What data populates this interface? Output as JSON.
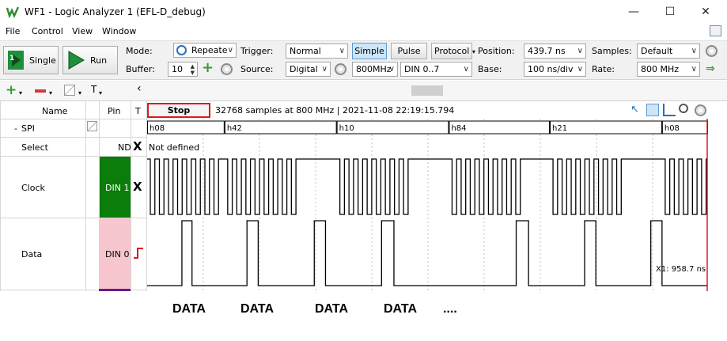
{
  "window": {
    "title": "WF1 - Logic Analyzer 1 (EFL-D_debug)",
    "minimize": "—",
    "maximize": "☐",
    "close": "✕"
  },
  "menu": [
    "File",
    "Control",
    "View",
    "Window"
  ],
  "toolbar": {
    "single_label": "Single",
    "run_label": "Run",
    "mode_label": "Mode:",
    "mode_value": "Repeate",
    "buffer_label": "Buffer:",
    "buffer_value": "10",
    "trigger_label": "Trigger:",
    "trigger_value": "Normal",
    "source_label": "Source:",
    "source_value": "Digital",
    "simple_label": "Simple",
    "pulse_label": "Pulse",
    "protocol_label": "Protocol",
    "freq_value": "800MHz",
    "din_value": "DIN 0..7",
    "position_label": "Position:",
    "position_value": "439.7 ns",
    "base_label": "Base:",
    "base_value": "100 ns/div",
    "samples_label": "Samples:",
    "samples_value": "Default",
    "rate_label": "Rate:",
    "rate_value": "800 MHz"
  },
  "toolbar2": {
    "add_icon": "plus-icon",
    "remove_icon": "minus-icon",
    "scroll_left": "‹"
  },
  "grid": {
    "col_name": "Name",
    "col_pin": "Pin",
    "col_t": "T",
    "stop_label": "Stop",
    "samples_info": "32768 samples at 800 MHz | 2021-11-08 22:19:15.794",
    "rows": [
      {
        "name": "SPI",
        "prefix": "-",
        "pin": "",
        "t": ""
      },
      {
        "name": "Select",
        "pin": "ND",
        "t": "X",
        "value": "Not defined"
      },
      {
        "name": "Clock",
        "pin": "DIN 1",
        "t": "X",
        "pin_color": "#0b7d0b"
      },
      {
        "name": "Data",
        "pin": "DIN 0",
        "t": "rising-edge-icon",
        "pin_color": "#f7c6cf"
      }
    ],
    "bus_values": [
      {
        "label": "h08",
        "t": 0.0
      },
      {
        "label": "h42",
        "t": 0.138
      },
      {
        "label": "h10",
        "t": 0.338
      },
      {
        "label": "h84",
        "t": 0.538
      },
      {
        "label": "h21",
        "t": 0.718
      },
      {
        "label": "h08",
        "t": 0.918
      }
    ],
    "cursor_label": "X1: 958.7 ns"
  },
  "annotations": [
    "DATA",
    "DATA",
    "DATA",
    "DATA",
    "...."
  ]
}
